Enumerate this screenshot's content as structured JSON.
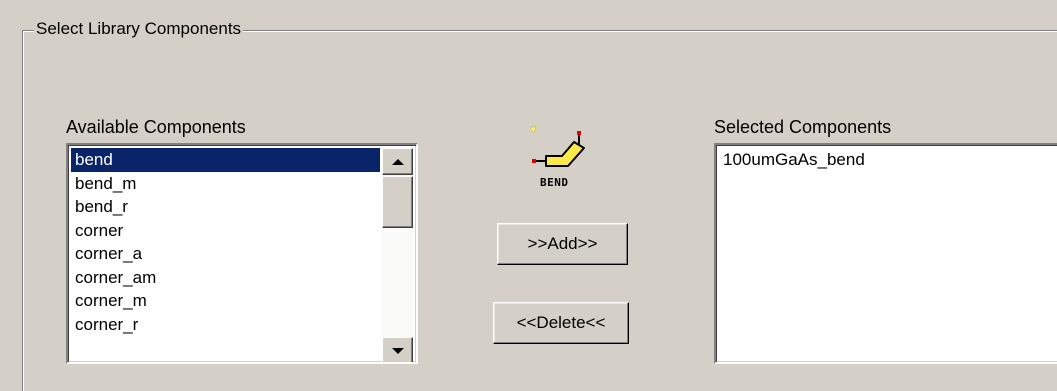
{
  "group": {
    "title": "Select Library Components"
  },
  "available": {
    "label": "Available Components",
    "items": [
      "bend",
      "bend_m",
      "bend_r",
      "corner",
      "corner_a",
      "corner_am",
      "corner_m",
      "corner_r"
    ],
    "selected_item": "bend"
  },
  "preview": {
    "icon": "bend-component-icon",
    "caption": "BEND"
  },
  "buttons": {
    "add": ">>Add>>",
    "delete": "<<Delete<<"
  },
  "selected": {
    "label": "Selected Components",
    "items": [
      "100umGaAs_bend"
    ]
  },
  "colors": {
    "selection": "#0a246a",
    "background": "#d4d0c8"
  }
}
